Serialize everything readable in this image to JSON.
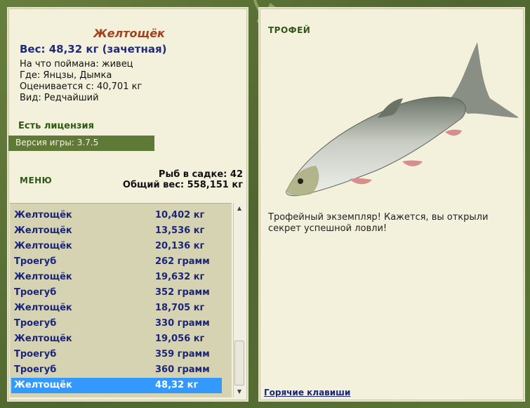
{
  "catch": {
    "name": "Желтощёк",
    "weight_line": "Вес: 48,32 кг (зачетная)",
    "bait": "На что поймана: живец",
    "location": "Где: Янцзы, Дымка",
    "valued": "Оценивается с: 40,701 кг",
    "kind": "Вид: Редчайший"
  },
  "license_label": "Есть лицензия",
  "version_label": "Версия игры: 3.7.5",
  "menu_label": "МЕНЮ",
  "keepnet": {
    "count_line": "Рыб в садке: 42",
    "total_line": "Общий вес: 558,151 кг"
  },
  "list": [
    {
      "name": "Желтощёк",
      "weight": "10,402 кг"
    },
    {
      "name": "Желтощёк",
      "weight": "13,536 кг"
    },
    {
      "name": "Желтощёк",
      "weight": "20,136 кг"
    },
    {
      "name": "Троегуб",
      "weight": "262 грамм"
    },
    {
      "name": "Желтощёк",
      "weight": "19,632 кг"
    },
    {
      "name": "Троегуб",
      "weight": "352 грамм"
    },
    {
      "name": "Желтощёк",
      "weight": "18,705 кг"
    },
    {
      "name": "Троегуб",
      "weight": "330 грамм"
    },
    {
      "name": "Желтощёк",
      "weight": "19,056 кг"
    },
    {
      "name": "Троегуб",
      "weight": "359 грамм"
    },
    {
      "name": "Троегуб",
      "weight": "360 грамм"
    },
    {
      "name": "Желтощёк",
      "weight": "48,32 кг",
      "selected": true
    }
  ],
  "trophy": {
    "title": "ТРОФЕЙ",
    "text": "Трофейный экземпляр! Кажется, вы открыли секрет успешной ловли!"
  },
  "hotkeys_label": "Горячие клавиши",
  "colors": {
    "frame": "#5a7035",
    "panel": "#f3f0dc",
    "list_bg": "#d6d3b3",
    "selected": "#3399ff",
    "fish_name": "#a0421b",
    "navy": "#1b2579"
  }
}
